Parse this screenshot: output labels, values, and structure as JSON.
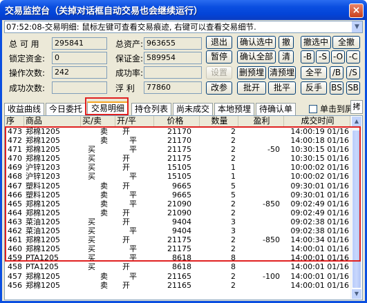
{
  "window": {
    "title": "交易监控台（关掉对话框自动交易也会继续运行）",
    "close_label": "×"
  },
  "ticker": "07:52:08-交易明细: 鼠标左键可查看交易痕迹, 右键可以查看交易细节.",
  "fields": {
    "total_available_label": "总 可 用",
    "total_available_value": "295841",
    "total_assets_label": "总资产:",
    "total_assets_value": "963655",
    "locked_funds_label": "锁定资金:",
    "locked_funds_value": "0",
    "margin_label": "保证金:",
    "margin_value": "589954",
    "op_count_label": "操作次数:",
    "op_count_value": "242",
    "success_rate_label": "成功率:",
    "success_rate_value": "",
    "success_count_label": "成功次数:",
    "success_count_value": "",
    "float_pnl_label": "浮  利",
    "float_pnl_value": "77860"
  },
  "buttons": {
    "exit": "退出",
    "confirm_selected": "确认选中",
    "cancel_one": "撤",
    "cancel_selected": "撤选中",
    "cancel_all": "全撤",
    "pause": "暂停",
    "confirm_all": "确认全部",
    "clear": "清",
    "b_s": "-B",
    "s_s": "-S",
    "o": "-O",
    "c": "-C",
    "settings": "设置",
    "delete_preorder": "删预埋",
    "clear_preorder": "清预埋",
    "all_flat": "全平",
    "b_slash": "/B",
    "s_slash": "/S",
    "modify_params": "改参",
    "close_long": "批开",
    "close_short": "批平",
    "reverse": "反手",
    "bs": "BS",
    "sb": "SB"
  },
  "tabs": [
    "收益曲线",
    "今日委托",
    "交易明细",
    "持仓列表",
    "尚未成交",
    "本地预埋",
    "待确认单"
  ],
  "active_tab": 2,
  "checkbox_label": "单击到屏",
  "expand_label": "拷",
  "columns": [
    "序",
    "商品",
    "买/卖",
    "开/平",
    "价格",
    "数量",
    "盈利",
    "成交时间"
  ],
  "rows": [
    [
      "473",
      "郑棉1205",
      "卖",
      "开",
      "21170",
      "2",
      "",
      "14:00:19 01/16"
    ],
    [
      "472",
      "郑棉1205",
      "卖",
      "平",
      "21170",
      "2",
      "",
      "14:00:18 01/16"
    ],
    [
      "471",
      "郑棉1205",
      "买",
      "平",
      "21175",
      "2",
      "-50",
      "10:30:15 01/16"
    ],
    [
      "470",
      "郑棉1205",
      "买",
      "开",
      "21175",
      "2",
      "",
      "10:30:15 01/16"
    ],
    [
      "469",
      "沪锌1203",
      "买",
      "开",
      "15105",
      "1",
      "",
      "10:00:02 01/16"
    ],
    [
      "468",
      "沪锌1203",
      "买",
      "平",
      "15105",
      "1",
      "",
      "10:00:02 01/16"
    ],
    [
      "467",
      "塑料1205",
      "卖",
      "开",
      "9665",
      "5",
      "",
      "09:30:01 01/16"
    ],
    [
      "466",
      "塑料1205",
      "卖",
      "平",
      "9665",
      "5",
      "",
      "09:30:01 01/16"
    ],
    [
      "465",
      "郑棉1205",
      "卖",
      "平",
      "21090",
      "2",
      "-850",
      "09:02:49 01/16"
    ],
    [
      "464",
      "郑棉1205",
      "卖",
      "开",
      "21090",
      "2",
      "",
      "09:02:49 01/16"
    ],
    [
      "463",
      "菜油1205",
      "买",
      "开",
      "9404",
      "3",
      "",
      "09:02:38 01/16"
    ],
    [
      "462",
      "菜油1205",
      "买",
      "平",
      "9404",
      "3",
      "",
      "09:02:38 01/16"
    ],
    [
      "461",
      "郑棉1205",
      "买",
      "开",
      "21175",
      "2",
      "-850",
      "14:00:34 01/16"
    ],
    [
      "460",
      "郑棉1205",
      "买",
      "平",
      "21175",
      "2",
      "",
      "14:00:01 01/16"
    ],
    [
      "459",
      "PTA1205",
      "买",
      "平",
      "8618",
      "8",
      "",
      "14:00:01 01/16"
    ],
    [
      "458",
      "PTA1205",
      "买",
      "开",
      "8618",
      "8",
      "",
      "14:00:01 01/16"
    ],
    [
      "457",
      "郑棉1205",
      "卖",
      "平",
      "21165",
      "2",
      "-100",
      "14:00:01 01/16"
    ],
    [
      "456",
      "郑棉1205",
      "卖",
      "开",
      "21165",
      "2",
      "",
      "14:00:01 01/16"
    ]
  ]
}
